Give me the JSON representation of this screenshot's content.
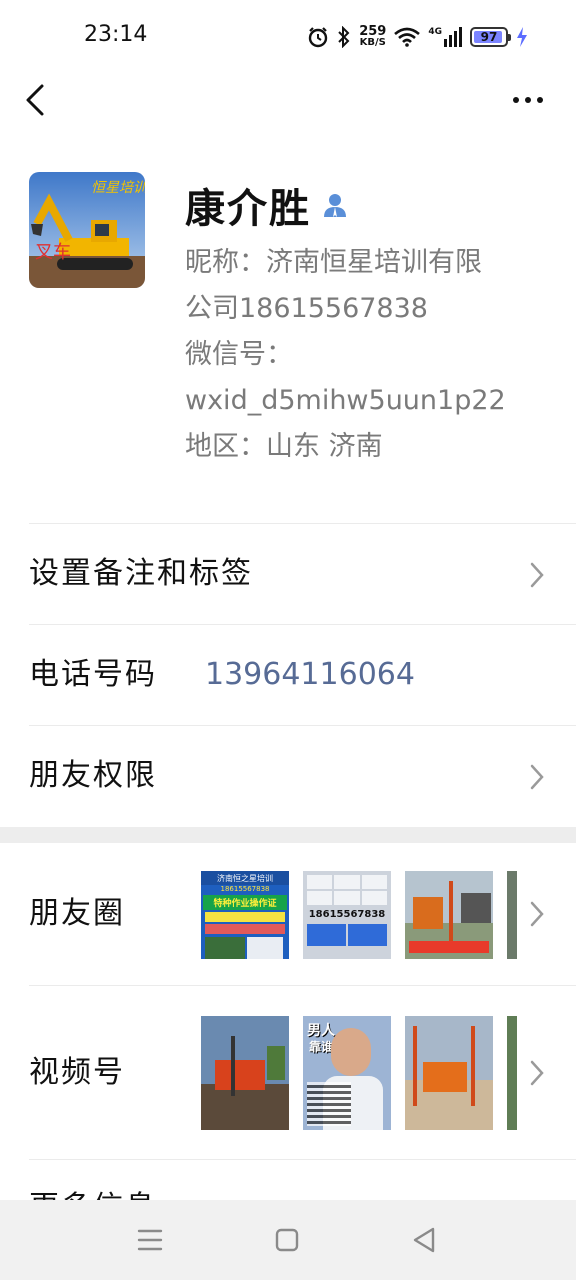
{
  "status_bar": {
    "time": "23:14",
    "speed_value": "259",
    "speed_unit": "KB/S",
    "network": "4G",
    "battery": "97"
  },
  "header": {
    "back_icon": "chevron-left-icon",
    "more_icon": "more-horizontal-icon"
  },
  "profile": {
    "name": "康介胜",
    "name_icon": "user-icon",
    "nickname_line1": "昵称：济南恒星培训有限",
    "nickname_line2": "公司18615567838",
    "wechat_id_label": "微信号：",
    "wechat_id_value": "wxid_d5mihw5uun1p22",
    "region": "地区：山东  济南"
  },
  "rows": {
    "remark_label": "设置备注和标签",
    "phone_label": "电话号码",
    "phone_value": "13964116064",
    "permissions_label": "朋友权限",
    "moments_label": "朋友圈",
    "channels_label": "视频号",
    "more_info_label": "更多信息"
  },
  "moments_thumbs": [
    {
      "title": "济南恒之星培训",
      "phone": "18615567838",
      "slogan": "特种作业操作证",
      "bg": "#1e5fbf"
    },
    {
      "phone": "18615567838",
      "bg": "#cdd3dc"
    },
    {
      "bg": "#8a9a7a"
    }
  ],
  "channels_thumbs": [
    {
      "bg": "#6a8ab0"
    },
    {
      "title": "男人",
      "sub": "靠谁",
      "bg": "#9db4d4"
    },
    {
      "bg": "#a7b7c9"
    }
  ],
  "colors": {
    "link": "#576b95",
    "secondary_text": "#7a7a7a",
    "divider_band": "#ededed",
    "nav_bg": "#f1f1f1"
  }
}
